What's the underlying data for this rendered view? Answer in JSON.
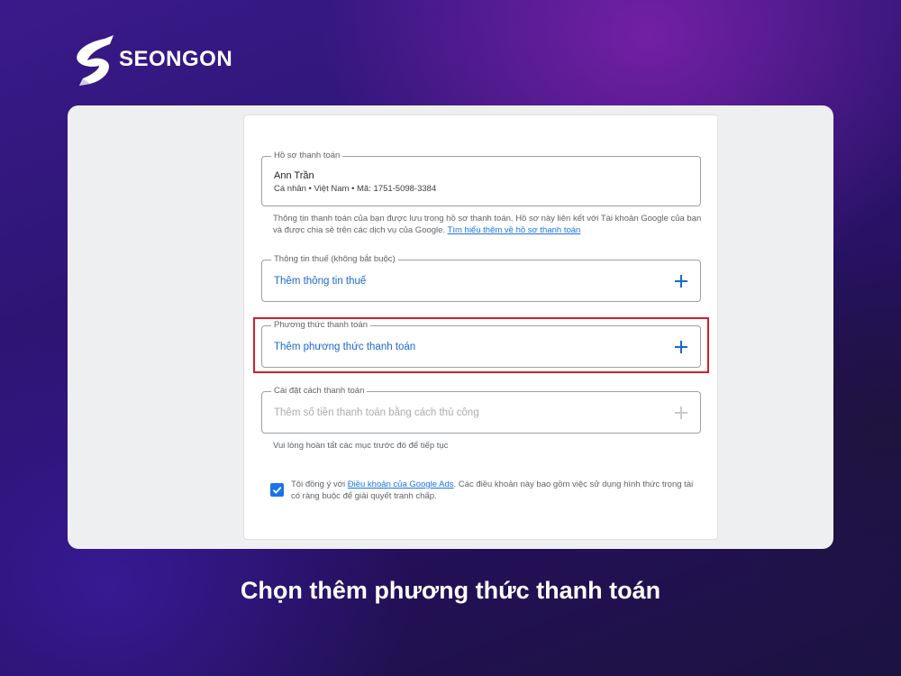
{
  "brand": {
    "name": "SEONGON"
  },
  "billing_profile": {
    "legend": "Hồ sơ thanh toán",
    "name": "Ann Trần",
    "detail": "Cá nhân • Việt Nam • Mã: 1751-5098-3384",
    "helper_text": "Thông tin thanh toán của bạn được lưu trong hồ sơ thanh toán. Hồ sơ này liên kết với Tài khoản Google của bạn và được chia sẻ trên các dịch vụ của Google.",
    "helper_link": "Tìm hiểu thêm về hồ sơ thanh toán"
  },
  "tax_info": {
    "legend": "Thông tin thuế (không bắt buộc)",
    "action": "Thêm thông tin thuế"
  },
  "payment_method": {
    "legend": "Phương thức thanh toán",
    "action": "Thêm phương thức thanh toán"
  },
  "payment_settings": {
    "legend": "Cài đặt cách thanh toán",
    "action": "Thêm số tiền thanh toán bằng cách thủ công",
    "helper_text": "Vui lòng hoàn tất các mục trước đó để tiếp tục"
  },
  "terms": {
    "checked": true,
    "prefix": "Tôi đồng ý với",
    "link": "Điều khoản của Google Ads",
    "suffix": ". Các điều khoản này bao gồm việc sử dụng hình thức trọng tài có ràng buộc để giải quyết tranh chấp."
  },
  "caption": "Chọn thêm phương thức thanh toán",
  "colors": {
    "accent": "#1a73e8",
    "highlight": "#d0202a"
  },
  "icons": [
    "seongon-logo-icon",
    "plus-icon",
    "checkbox-checked-icon"
  ]
}
